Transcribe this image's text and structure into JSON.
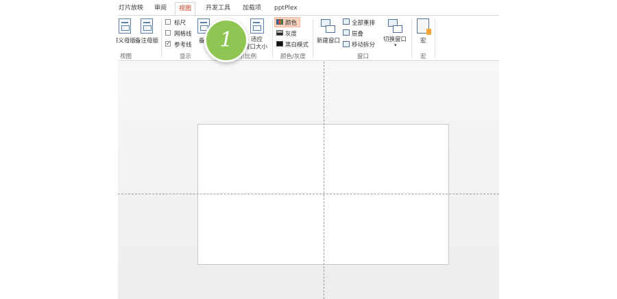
{
  "tabs": [
    {
      "label": "灯片放映"
    },
    {
      "label": "审阅"
    },
    {
      "label": "视图"
    },
    {
      "label": "开发工具"
    },
    {
      "label": "加载项"
    },
    {
      "label": "pptPlex"
    }
  ],
  "active_tab": "视图",
  "ribbon": {
    "views": {
      "handout_master": "讲义母版",
      "notes_master": "备注母版",
      "group_label": "视图"
    },
    "show": {
      "ruler": {
        "label": "标尺",
        "checked": false
      },
      "gridlines": {
        "label": "网格线",
        "checked": false
      },
      "guides": {
        "label": "参考线",
        "checked": true
      },
      "notes_partial": "备",
      "group_label": "显示"
    },
    "zoom": {
      "fit_window_line1": "适应",
      "fit_window_line2": "窗口大小",
      "group_label": "显示比例"
    },
    "color": {
      "color_label": "颜色",
      "grayscale_label": "灰度",
      "bw_label": "黑白模式",
      "group_label": "颜色/灰度"
    },
    "window": {
      "new_window": "新建窗口",
      "arrange_all": "全部重排",
      "cascade": "层叠",
      "move_split": "移动拆分",
      "switch_windows": "切换窗口",
      "group_label": "窗口"
    },
    "macros": {
      "macros_label": "宏",
      "group_label": "宏"
    }
  },
  "callout": {
    "number": "1",
    "color": "#8fc552"
  },
  "colors": {
    "active_tab_text": "#c43e1c",
    "color_highlight": "#f9d3bf",
    "workspace_bg": "#f2f2f2"
  }
}
